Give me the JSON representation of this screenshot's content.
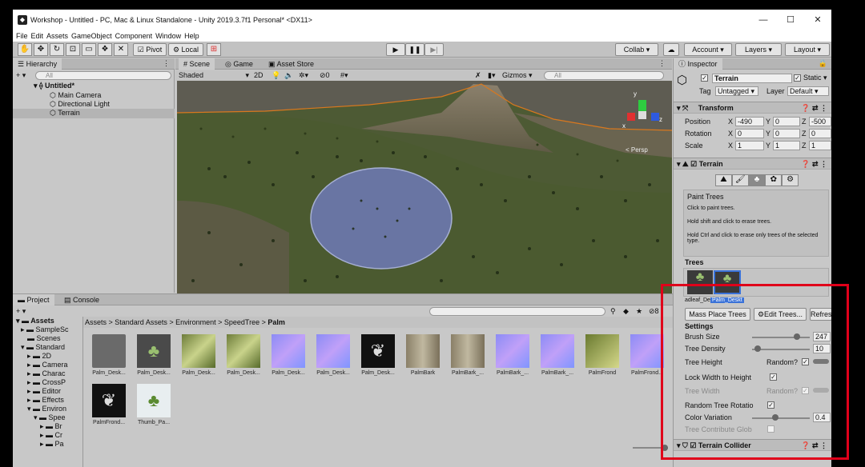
{
  "window": {
    "title": "Workshop - Untitled - PC, Mac & Linux Standalone - Unity 2019.3.7f1 Personal* <DX11>",
    "app_icon": "unity-logo-icon",
    "minimize": "—",
    "maximize": "☐",
    "close": "✕"
  },
  "menu": [
    "File",
    "Edit",
    "Assets",
    "GameObject",
    "Component",
    "Window",
    "Help"
  ],
  "toolbar": {
    "tools": [
      "hand-tool-icon",
      "move-tool-icon",
      "rotate-tool-icon",
      "scale-tool-icon",
      "rect-tool-icon",
      "transform-tool-icon",
      "custom-tool-icon"
    ],
    "pivot": "Pivot",
    "local": "Local",
    "collab": "Collab ▾",
    "account": "Account",
    "layers": "Layers",
    "layout": "Layout"
  },
  "hierarchy": {
    "tab": "Hierarchy",
    "search_placeholder": "All",
    "scene": "Untitled*",
    "items": [
      "Main Camera",
      "Directional Light",
      "Terrain"
    ]
  },
  "scene_view": {
    "tabs": [
      "Scene",
      "Game",
      "Asset Store"
    ],
    "shading": "Shaded",
    "mode_2d": "2D",
    "fx_count": "0",
    "gizmos": "Gizmos",
    "search_placeholder": "All",
    "persp": "< Persp",
    "axes": {
      "x": "x",
      "y": "y",
      "z": "z"
    }
  },
  "inspector": {
    "tab": "Inspector",
    "object_name": "Terrain",
    "static_label": "Static",
    "tag_label": "Tag",
    "tag_value": "Untagged",
    "layer_label": "Layer",
    "layer_value": "Default",
    "transform": {
      "title": "Transform",
      "position_label": "Position",
      "rotation_label": "Rotation",
      "scale_label": "Scale",
      "position": {
        "x": "-490",
        "y": "0",
        "z": "-500"
      },
      "rotation": {
        "x": "0",
        "y": "0",
        "z": "0"
      },
      "scale": {
        "x": "1",
        "y": "1",
        "z": "1"
      }
    },
    "terrain": {
      "title": "Terrain",
      "paint_title": "Paint Trees",
      "help1": "Click to paint trees.",
      "help2": "Hold shift and click to erase trees.",
      "help3": "Hold Ctrl and click to erase only trees of the selected type.",
      "trees_label": "Trees",
      "tree_name": "adleaf_Desk",
      "tree_name_selected": "Palm_Deskt",
      "mass_place": "Mass Place Trees",
      "edit_trees": "Edit Trees...",
      "refresh": "Refres",
      "settings_label": "Settings",
      "brush_size_label": "Brush Size",
      "brush_size": "247",
      "brush_size_fraction": 0.78,
      "tree_density_label": "Tree Density",
      "tree_density": "10",
      "tree_density_fraction": 0.1,
      "tree_height_label": "Tree Height",
      "random_label": "Random?",
      "lock_width_label": "Lock Width to Height",
      "tree_width_label": "Tree Width",
      "random_rotation_label": "Random Tree Rotatio",
      "color_variation_label": "Color Variation",
      "color_variation": "0.4",
      "color_variation_fraction": 0.4,
      "contribute_gi_label": "Tree Contribute Glob"
    },
    "collider_title": "Terrain Collider"
  },
  "project": {
    "tabs": [
      "Project",
      "Console"
    ],
    "breadcrumb": [
      "Assets",
      "Standard Assets",
      "Environment",
      "SpeedTree",
      "Palm"
    ],
    "folders": [
      "Assets",
      "SampleSc",
      "Scenes",
      "Standard",
      "2D",
      "Camera",
      "Charac",
      "CrossP",
      "Editor",
      "Effects",
      "Environ",
      "Spee",
      "Br",
      "Cr",
      "Pa"
    ],
    "assets": [
      {
        "name": "Palm_Desk...",
        "kind": "folder"
      },
      {
        "name": "Palm_Desk...",
        "kind": "model"
      },
      {
        "name": "Palm_Desk...",
        "kind": "texture"
      },
      {
        "name": "Palm_Desk...",
        "kind": "texture"
      },
      {
        "name": "Palm_Desk...",
        "kind": "normal"
      },
      {
        "name": "Palm_Desk...",
        "kind": "normal"
      },
      {
        "name": "Palm_Desk...",
        "kind": "dark"
      },
      {
        "name": "PalmBark",
        "kind": "bark"
      },
      {
        "name": "PalmBark_...",
        "kind": "bark"
      },
      {
        "name": "PalmBark_...",
        "kind": "normal"
      },
      {
        "name": "PalmBark_...",
        "kind": "normal"
      },
      {
        "name": "PalmFrond",
        "kind": "frond"
      },
      {
        "name": "PalmFrond...",
        "kind": "normal"
      },
      {
        "name": "PalmFrond...",
        "kind": "dark"
      },
      {
        "name": "Thumb_Pa...",
        "kind": "palm"
      }
    ],
    "count_badge": "8"
  },
  "colors": {
    "highlight_box": "#e0001a",
    "selection": "#3a72d8",
    "terrain": "#4a5a32"
  }
}
